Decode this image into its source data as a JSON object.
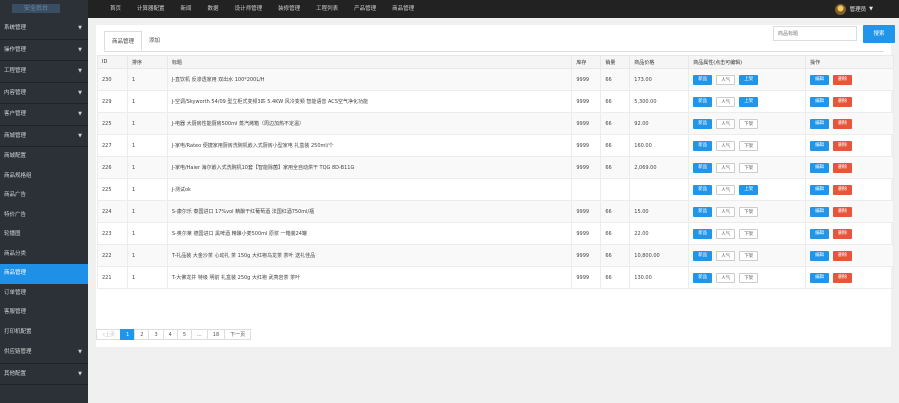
{
  "logo": {
    "text": "安全后台"
  },
  "topnav": [
    "首页",
    "计算器配置",
    "新闻",
    "数据",
    "设计师管理",
    "装修管理",
    "工程列表",
    "产品管理",
    "商品管理"
  ],
  "admin": {
    "name": "管理员"
  },
  "sidebar": {
    "groups_top": [
      {
        "label": "系统管理"
      },
      {
        "label": "操作管理"
      },
      {
        "label": "工程管理"
      },
      {
        "label": "内容管理"
      },
      {
        "label": "客户管理"
      },
      {
        "label": "商城管理"
      }
    ],
    "subitems": [
      {
        "label": "商城配置",
        "active": false
      },
      {
        "label": "商品规格组",
        "active": false
      },
      {
        "label": "商品广告",
        "active": false
      },
      {
        "label": "特价广告",
        "active": false
      },
      {
        "label": "轮播图",
        "active": false
      },
      {
        "label": "商品分类",
        "active": false
      },
      {
        "label": "商品管理",
        "active": true
      },
      {
        "label": "订单管理",
        "active": false
      },
      {
        "label": "客服管理",
        "active": false
      },
      {
        "label": "打印机配置",
        "active": false
      }
    ],
    "groups_bottom": [
      {
        "label": "供应链管理"
      },
      {
        "label": "其他配置"
      }
    ]
  },
  "tabs": [
    {
      "label": "商品管理",
      "active": true
    },
    {
      "label": "添加",
      "active": false
    }
  ],
  "search": {
    "placeholder": "商品标题",
    "button": "搜索"
  },
  "table": {
    "headers": [
      "ID",
      "排序",
      "标题",
      "库存",
      "销量",
      "商品价格",
      "商品属性(点击可编辑)",
      "操作"
    ],
    "attr_labels": {
      "new": "新品",
      "hot": "人气",
      "up": "上架",
      "down": "下架"
    },
    "action_labels": {
      "edit": "编辑",
      "delete": "删除"
    },
    "rows": [
      {
        "id": "230",
        "sort": "1",
        "title": "J-直饮机 反渗透家用 双出水 100*200L/H",
        "stock": "9999",
        "sales": "66",
        "price": "173.00",
        "status": "上架",
        "up": true
      },
      {
        "id": "229",
        "sort": "1",
        "title": "J-空调/Skyworth 54/09 型立柜式变频3匹 5.4KW 风冷变频 智能语音 ACS空气净化功能",
        "stock": "9999",
        "sales": "66",
        "price": "5,300.00",
        "status": "上架",
        "up": true
      },
      {
        "id": "225",
        "sort": "1",
        "title": "J-电器 大厨房性能厨房500ml 蒸汽烤箱（周边加热不定温）",
        "stock": "9999",
        "sales": "66",
        "price": "92.00",
        "status": "下架",
        "up": false
      },
      {
        "id": "227",
        "sort": "1",
        "title": "J-家电/Rateo 便捷家用厨房洗碗机嵌入式厨房小型家电 礼盒装 250ml/个",
        "stock": "9999",
        "sales": "66",
        "price": "160.00",
        "status": "下架",
        "up": false
      },
      {
        "id": "226",
        "sort": "1",
        "title": "J-家电/Haier 海尔嵌入式洗碗机10套【智能除菌】家用全自动烘干 TQG 8D-B11G",
        "stock": "9999",
        "sales": "66",
        "price": "2,069.00",
        "status": "下架",
        "up": false
      },
      {
        "id": "225",
        "sort": "1",
        "title": "J-测试ok",
        "stock": "",
        "sales": "",
        "price": "",
        "status": "上架",
        "up": true
      },
      {
        "id": "224",
        "sort": "1",
        "title": "S-康尔乐 泰国进口 17%vol 精酿干红葡萄酒 法国红酒750ml/瓶",
        "stock": "9999",
        "sales": "66",
        "price": "15.00",
        "status": "下架",
        "up": false
      },
      {
        "id": "223",
        "sort": "1",
        "title": "S-奥尔莱 德国进口 黑啤酒 精酿小麦500ml 原浆 一箱装24罐",
        "stock": "9999",
        "sales": "66",
        "price": "22.00",
        "status": "下架",
        "up": false
      },
      {
        "id": "222",
        "sort": "1",
        "title": "T-礼品装 大金沙茶 心动礼 茶 150g 大红袍乌龙茶 茶叶 送礼佳品",
        "stock": "9999",
        "sales": "66",
        "price": "10,800.00",
        "status": "下架",
        "up": false
      },
      {
        "id": "221",
        "sort": "1",
        "title": "T-大佛龙井 特级 明前 礼盒装 250g 大红袍 武夷岩茶 茶叶",
        "stock": "9999",
        "sales": "66",
        "price": "130.00",
        "status": "下架",
        "up": false
      }
    ]
  },
  "pagination": {
    "prev": "«上页",
    "pages": [
      "1",
      "2",
      "3",
      "4",
      "5"
    ],
    "ellipsis": "...",
    "last": "18",
    "next": "下一页"
  }
}
